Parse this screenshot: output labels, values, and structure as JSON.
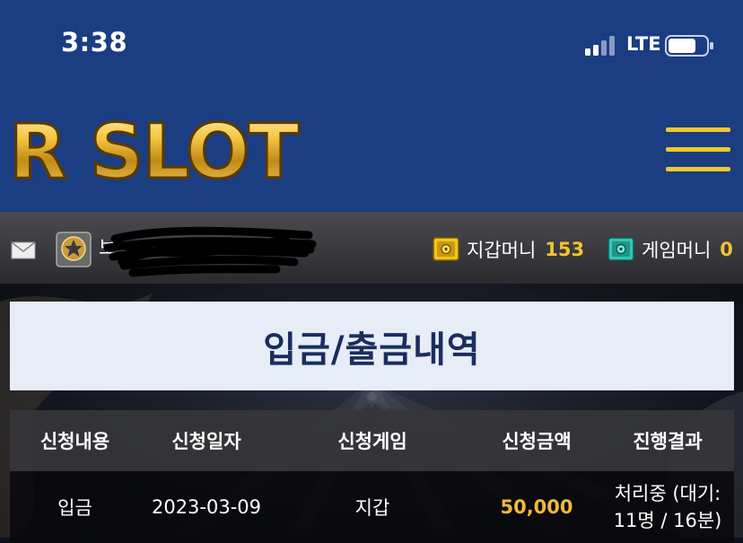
{
  "status_bar": {
    "time": "3:38",
    "network": "LTE"
  },
  "header": {
    "logo_text": "R SLOT",
    "menu_icon": "hamburger-icon"
  },
  "user_bar": {
    "mail_icon": "mail-icon",
    "rank_icon": "rank-star-badge-icon",
    "username_visible": "보",
    "wallet_money": {
      "label": "지갑머니",
      "value": "153",
      "icon": "safe-icon"
    },
    "game_money": {
      "label": "게임머니",
      "value": "0",
      "icon": "safe-icon"
    }
  },
  "page": {
    "title": "입금/출금내역"
  },
  "table": {
    "headers": [
      "신청내용",
      "신청일자",
      "신청게임",
      "신청금액",
      "진행결과"
    ],
    "rows": [
      {
        "type": "입금",
        "date": "2023-03-09",
        "game": "지갑",
        "amount": "50,000",
        "status_line1": "처리중 (대기:",
        "status_line2": "11명 / 16분)"
      }
    ]
  },
  "colors": {
    "header_blue": "#1b3d82",
    "gold": "#f1c331",
    "title_navy": "#1a2d5e",
    "banner_bg": "#e6edf7"
  }
}
